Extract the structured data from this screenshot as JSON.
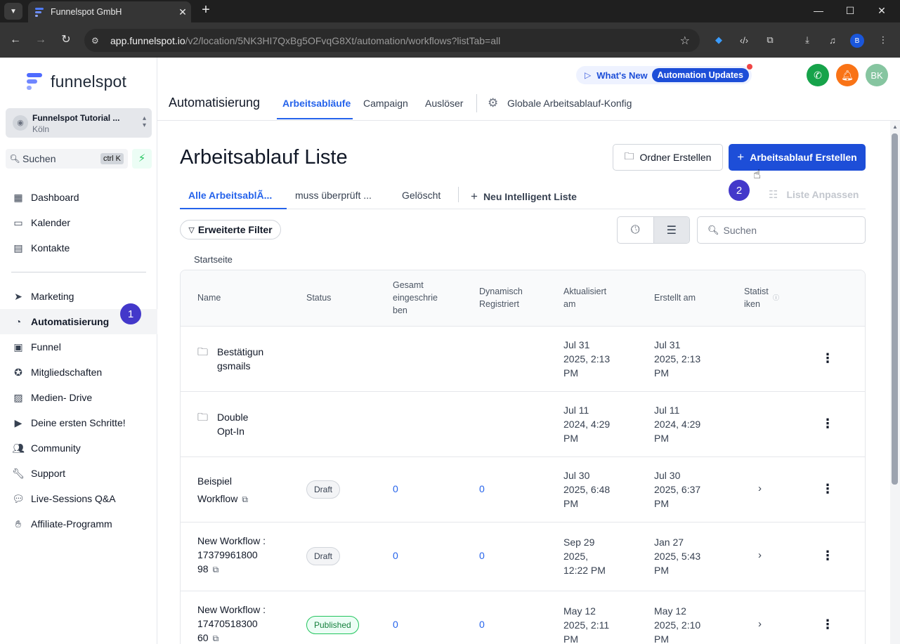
{
  "browser": {
    "tab_title": "Funnelspot GmbH",
    "url_host": "app.funnelspot.io",
    "url_path": "/v2/location/5NK3HI7QxBg5OFvqG8Xt/automation/workflows?listTab=all",
    "profile_initial": "B"
  },
  "sidebar": {
    "logo_text": "funnelspot",
    "account_name": "Funnelspot Tutorial ...",
    "account_location": "Köln",
    "search_label": "Suchen",
    "search_shortcut": "ctrl K",
    "items": [
      {
        "label": "Dashboard",
        "icon": "dashboard-icon"
      },
      {
        "label": "Kalender",
        "icon": "calendar-icon"
      },
      {
        "label": "Kontakte",
        "icon": "contacts-icon"
      },
      {
        "label": "Marketing",
        "icon": "send-icon"
      },
      {
        "label": "Automatisierung",
        "icon": "automation-icon"
      },
      {
        "label": "Funnel",
        "icon": "funnel-icon"
      },
      {
        "label": "Mitgliedschaften",
        "icon": "badge-icon"
      },
      {
        "label": "Medien- Drive",
        "icon": "image-icon"
      },
      {
        "label": "Deine ersten Schritte!",
        "icon": "play-icon"
      },
      {
        "label": "Community",
        "icon": "community-icon"
      },
      {
        "label": "Support",
        "icon": "wrench-icon"
      },
      {
        "label": "Live-Sessions Q&A",
        "icon": "chat-icon"
      },
      {
        "label": "Affiliate-Programm",
        "icon": "affiliate-icon"
      }
    ],
    "step_badge": "1"
  },
  "header": {
    "whats_new": "What's New",
    "automation_updates": "Automation Updates",
    "avatar_initials": "BK",
    "title": "Automatisierung",
    "tabs": [
      "Arbeitsabläufe",
      "Campaign",
      "Auslöser"
    ],
    "global_config": "Globale Arbeitsablauf-Konfig"
  },
  "main": {
    "page_title": "Arbeitsablauf Liste",
    "create_folder": "Ordner Erstellen",
    "create_workflow": "Arbeitsablauf Erstellen",
    "step_badge": "2",
    "subtabs": [
      "Alle ArbeitsablÃ...",
      "muss überprüft ...",
      "Gelöscht"
    ],
    "new_smart_list": "Neu Intelligent Liste",
    "customize_list": "Liste Anpassen",
    "advanced_filter": "Erweiterte Filter",
    "search_placeholder": "Suchen",
    "breadcrumb": "Startseite"
  },
  "table": {
    "headers": {
      "name": "Name",
      "status": "Status",
      "enrolled": "Gesamt\neingeschrie\nben",
      "dynamic": "Dynamisch\nRegistriert",
      "updated": "Aktualisiert\nam",
      "created": "Erstellt am",
      "stats": "Statist\niken"
    },
    "rows": [
      {
        "name": "Bestätigun\ngsmails",
        "is_folder": true,
        "status": "",
        "enrolled": "",
        "dynamic": "",
        "updated": "Jul 31\n2025, 2:13\nPM",
        "created": "Jul 31\n2025, 2:13\nPM"
      },
      {
        "name": "Double\nOpt-In",
        "is_folder": true,
        "status": "",
        "enrolled": "",
        "dynamic": "",
        "updated": "Jul 11\n2024, 4:29\nPM",
        "created": "Jul 11\n2024, 4:29\nPM"
      },
      {
        "name": "Beispiel\nWorkflow",
        "is_folder": false,
        "status": "Draft",
        "enrolled": "0",
        "dynamic": "0",
        "updated": "Jul 30\n2025, 6:48\nPM",
        "created": "Jul 30\n2025, 6:37\nPM"
      },
      {
        "name": "New Workflow :\n17379961800\n98",
        "is_folder": false,
        "status": "Draft",
        "enrolled": "0",
        "dynamic": "0",
        "updated": "Sep 29\n2025,\n12:22 PM",
        "created": "Jan 27\n2025, 5:43\nPM"
      },
      {
        "name": "New Workflow :\n17470518300\n60",
        "is_folder": false,
        "status": "Published",
        "enrolled": "0",
        "dynamic": "0",
        "updated": "May 12\n2025, 2:11\nPM",
        "created": "May 12\n2025, 2:10\nPM"
      }
    ]
  },
  "colors": {
    "accent": "#1d4ed8",
    "phone": "#16a34a",
    "bell": "#f97316",
    "avatar": "#86c5a0",
    "step_badge": "#4338ca"
  }
}
